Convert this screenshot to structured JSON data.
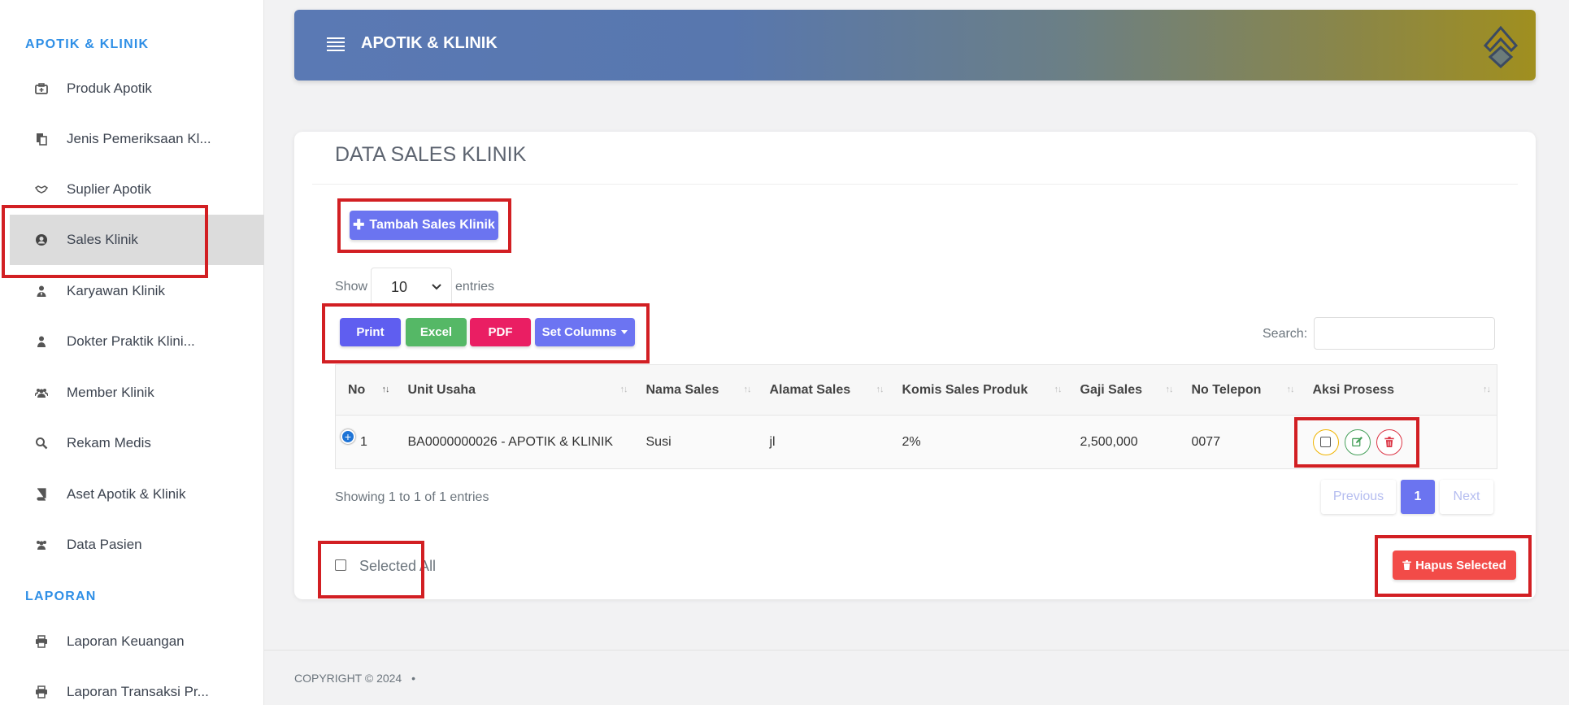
{
  "sidebar": {
    "heading_main": "APOTIK & KLINIK",
    "items": [
      {
        "label": "Produk Apotik",
        "icon": "medkit-icon"
      },
      {
        "label": "Jenis Pemeriksaan Kl...",
        "icon": "files-icon"
      },
      {
        "label": "Suplier Apotik",
        "icon": "handshake-icon"
      },
      {
        "label": "Sales Klinik",
        "icon": "user-circle-icon"
      },
      {
        "label": "Karyawan Klinik",
        "icon": "user-tie-icon"
      },
      {
        "label": "Dokter Praktik Klini...",
        "icon": "user-icon"
      },
      {
        "label": "Member Klinik",
        "icon": "users-icon"
      },
      {
        "label": "Rekam Medis",
        "icon": "search-icon"
      },
      {
        "label": "Aset Apotik & Klinik",
        "icon": "book-icon"
      },
      {
        "label": "Data Pasien",
        "icon": "users-icon"
      }
    ],
    "heading_report": "LAPORAN",
    "report_items": [
      {
        "label": "Laporan Keuangan",
        "icon": "printer-icon"
      },
      {
        "label": "Laporan Transaksi Pr...",
        "icon": "printer-icon"
      }
    ]
  },
  "header": {
    "title": "APOTIK & KLINIK"
  },
  "main": {
    "title": "DATA SALES KLINIK",
    "add_button": "Tambah Sales Klinik",
    "show_label": "Show",
    "entries_value": "10",
    "entries_label": "entries",
    "export_buttons": {
      "print": "Print",
      "excel": "Excel",
      "pdf": "PDF",
      "columns": "Set Columns"
    },
    "search_label": "Search:",
    "table": {
      "columns": [
        "No",
        "Unit Usaha",
        "Nama Sales",
        "Alamat Sales",
        "Komis Sales Produk",
        "Gaji Sales",
        "No Telepon",
        "Aksi Prosess"
      ],
      "rows": [
        {
          "no": "1",
          "unit": "BA0000000026 - APOTIK & KLINIK",
          "nama": "Susi",
          "alamat": "jl",
          "komisi": "2%",
          "gaji": "2,500,000",
          "telepon": "0077"
        }
      ]
    },
    "info": "Showing 1 to 1 of 1 entries",
    "pagination": {
      "previous": "Previous",
      "current": "1",
      "next": "Next"
    },
    "selected_all": "Selected All",
    "delete_selected": "Hapus Selected"
  },
  "footer": {
    "copyright": "COPYRIGHT © 2024",
    "dot": "•"
  },
  "colors": {
    "accent": "#6b74f0",
    "heading": "#2f8fe6",
    "danger": "#f24b48",
    "highlight": "#d21f23"
  }
}
